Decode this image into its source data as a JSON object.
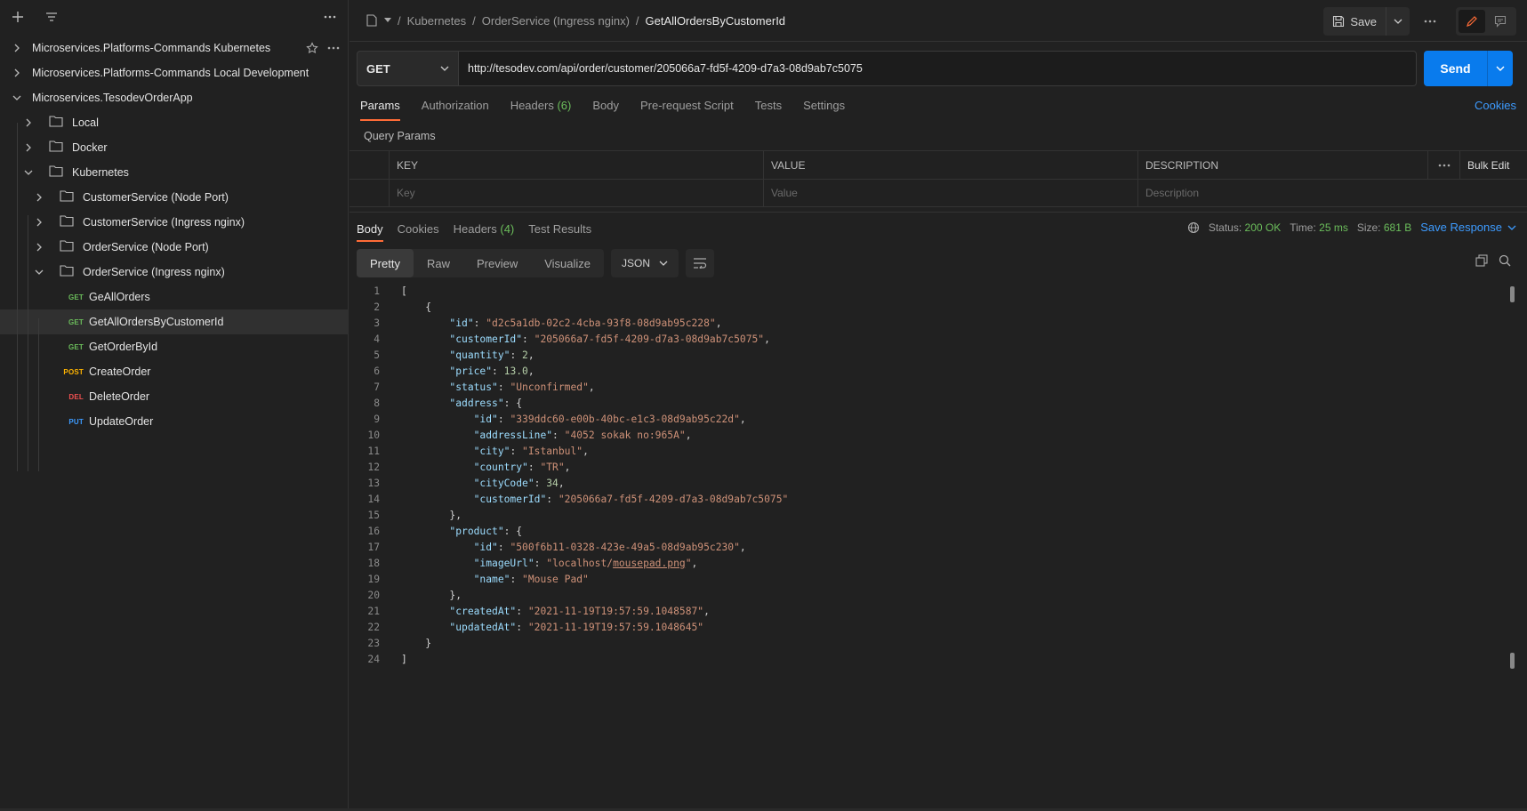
{
  "sidebar": {
    "collections": [
      {
        "name": "Microservices.Platforms-Commands Kubernetes"
      },
      {
        "name": "Microservices.Platforms-Commands Local Development"
      },
      {
        "name": "Microservices.TesodevOrderApp"
      }
    ],
    "folders": {
      "local": "Local",
      "docker": "Docker",
      "kubernetes": "Kubernetes",
      "customer_node": "CustomerService (Node Port)",
      "customer_ingress": "CustomerService (Ingress nginx)",
      "order_node": "OrderService (Node Port)",
      "order_ingress": "OrderService (Ingress nginx)"
    },
    "requests": [
      {
        "method": "GET",
        "name": "GeAllOrders"
      },
      {
        "method": "GET",
        "name": "GetAllOrdersByCustomerId"
      },
      {
        "method": "GET",
        "name": "GetOrderById"
      },
      {
        "method": "POST",
        "name": "CreateOrder"
      },
      {
        "method": "DEL",
        "name": "DeleteOrder"
      },
      {
        "method": "PUT",
        "name": "UpdateOrder"
      }
    ]
  },
  "header": {
    "sep": "/",
    "crumb1": "Kubernetes",
    "crumb2": "OrderService (Ingress nginx)",
    "current": "GetAllOrdersByCustomerId",
    "save_label": "Save"
  },
  "request": {
    "method": "GET",
    "url": "http://tesodev.com/api/order/customer/205066a7-fd5f-4209-d7a3-08d9ab7c5075",
    "send_label": "Send",
    "tabs": {
      "params": "Params",
      "authorization": "Authorization",
      "headers": "Headers",
      "headers_count": "(6)",
      "body": "Body",
      "prerequest": "Pre-request Script",
      "tests": "Tests",
      "settings": "Settings"
    },
    "cookies_link": "Cookies",
    "query_params_label": "Query Params",
    "table": {
      "col_key": "KEY",
      "col_value": "VALUE",
      "col_description": "DESCRIPTION",
      "bulk_edit": "Bulk Edit",
      "ph_key": "Key",
      "ph_value": "Value",
      "ph_description": "Description"
    }
  },
  "response": {
    "tabs": {
      "body": "Body",
      "cookies": "Cookies",
      "headers": "Headers",
      "headers_count": "(4)",
      "test_results": "Test Results"
    },
    "status_label": "Status:",
    "status": "200 OK",
    "time_label": "Time:",
    "time": "25 ms",
    "size_label": "Size:",
    "size": "681 B",
    "save_response": "Save Response",
    "views": {
      "pretty": "Pretty",
      "raw": "Raw",
      "preview": "Preview",
      "visualize": "Visualize"
    },
    "format": "JSON"
  },
  "body_lines": [
    "1",
    "2",
    "3",
    "4",
    "5",
    "6",
    "7",
    "8",
    "9",
    "10",
    "11",
    "12",
    "13",
    "14",
    "15",
    "16",
    "17",
    "18",
    "19",
    "20",
    "21",
    "22",
    "23",
    "24"
  ],
  "json": {
    "keys": {
      "id": "\"id\"",
      "customerId": "\"customerId\"",
      "quantity": "\"quantity\"",
      "price": "\"price\"",
      "status": "\"status\"",
      "address": "\"address\"",
      "addressLine": "\"addressLine\"",
      "city": "\"city\"",
      "country": "\"country\"",
      "cityCode": "\"cityCode\"",
      "product": "\"product\"",
      "imageUrl": "\"imageUrl\"",
      "name": "\"name\"",
      "createdAt": "\"createdAt\"",
      "updatedAt": "\"updatedAt\""
    },
    "values": {
      "order_id": "\"d2c5a1db-02c2-4cba-93f8-08d9ab95c228\"",
      "customer_id": "\"205066a7-fd5f-4209-d7a3-08d9ab7c5075\"",
      "quantity": "2",
      "price": "13.0",
      "status": "\"Unconfirmed\"",
      "address_id": "\"339ddc60-e00b-40bc-e1c3-08d9ab95c22d\"",
      "address_line": "\"4052 sokak no:965A\"",
      "city": "\"Istanbul\"",
      "country": "\"TR\"",
      "city_code": "34",
      "address_customer_id": "\"205066a7-fd5f-4209-d7a3-08d9ab7c5075\"",
      "product_id": "\"500f6b11-0328-423e-49a5-08d9ab95c230\"",
      "image_url_q1": "\"",
      "image_url_host": "localhost/",
      "image_url_file": "mousepad.png",
      "image_url_q2": "\"",
      "product_name": "\"Mouse Pad\"",
      "created_at": "\"2021-11-19T19:57:59.1048587\"",
      "updated_at": "\"2021-11-19T19:57:59.1048645\""
    }
  }
}
